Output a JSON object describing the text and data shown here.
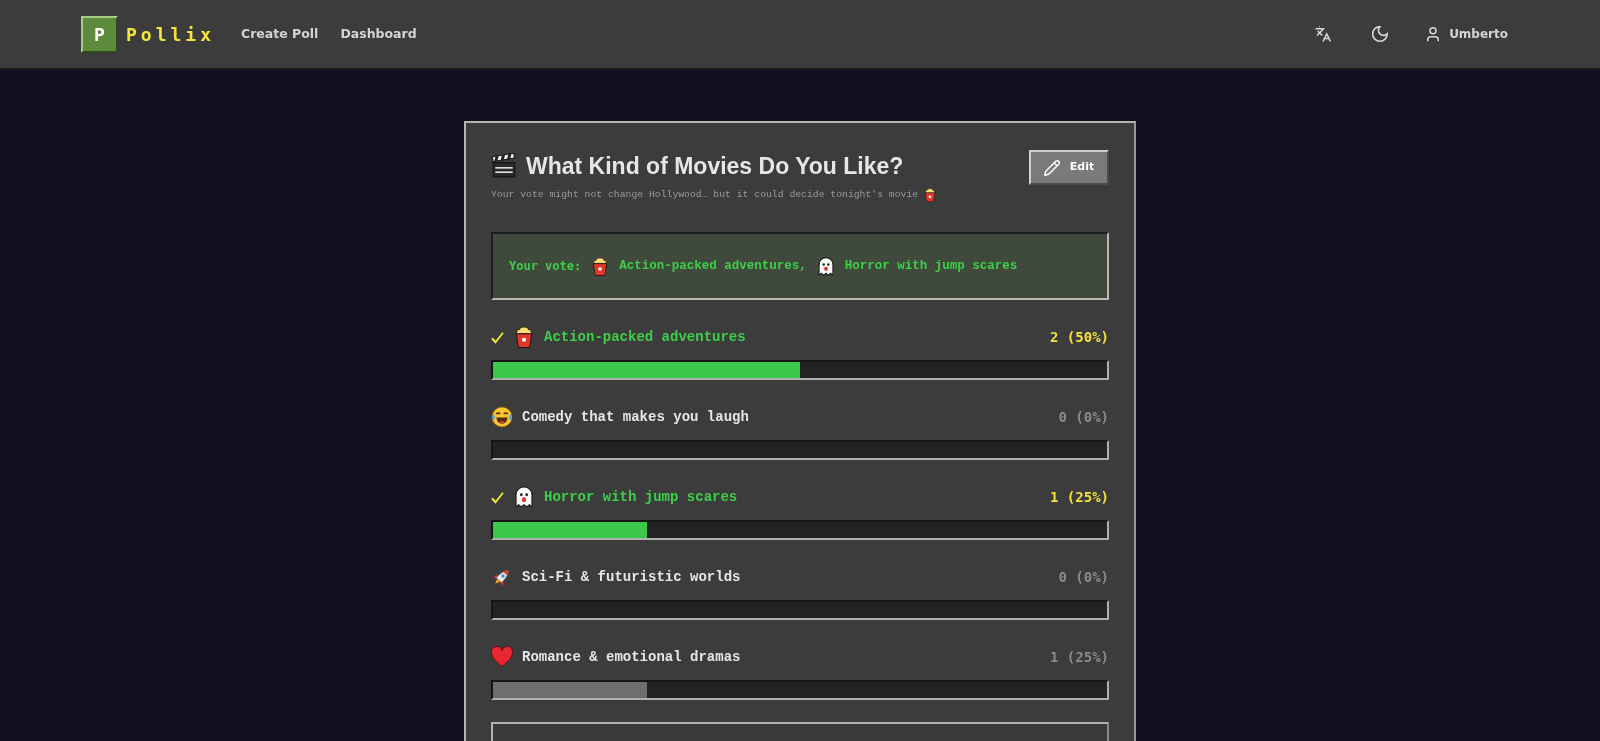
{
  "header": {
    "logo_letter": "P",
    "brand": "Pollix",
    "nav": [
      {
        "label": "Create Poll"
      },
      {
        "label": "Dashboard"
      }
    ],
    "user": {
      "name": "Umberto"
    }
  },
  "poll": {
    "title": "What Kind of Movies Do You Like?",
    "subtitle": "Your vote might not change Hollywood… but it could decide tonight's movie",
    "edit_button": "Edit",
    "your_vote": {
      "label": "Your vote:",
      "choices": [
        {
          "kind": "popcorn",
          "text": "Action-packed adventures,"
        },
        {
          "kind": "ghost",
          "text": "Horror with jump scares"
        }
      ]
    },
    "options": [
      {
        "kind": "popcorn",
        "label": "Action-packed adventures",
        "voted": true,
        "count": "2 (50%)",
        "level": 0.5
      },
      {
        "kind": "laugh",
        "label": "Comedy that makes you laugh",
        "voted": false,
        "count": "0 (0%)"
      },
      {
        "kind": "ghost",
        "label": "Horror with jump scares",
        "voted": true,
        "count": "1 (25%)",
        "level": 0.25
      },
      {
        "kind": "rocket",
        "label": "Sci-Fi & futuristic worlds",
        "voted": false,
        "count": "0 (0%)"
      },
      {
        "kind": "heart",
        "label": "Romance & emotional dramas",
        "voted": false,
        "count": "1 (25%)",
        "level": 0.25
      }
    ]
  }
}
